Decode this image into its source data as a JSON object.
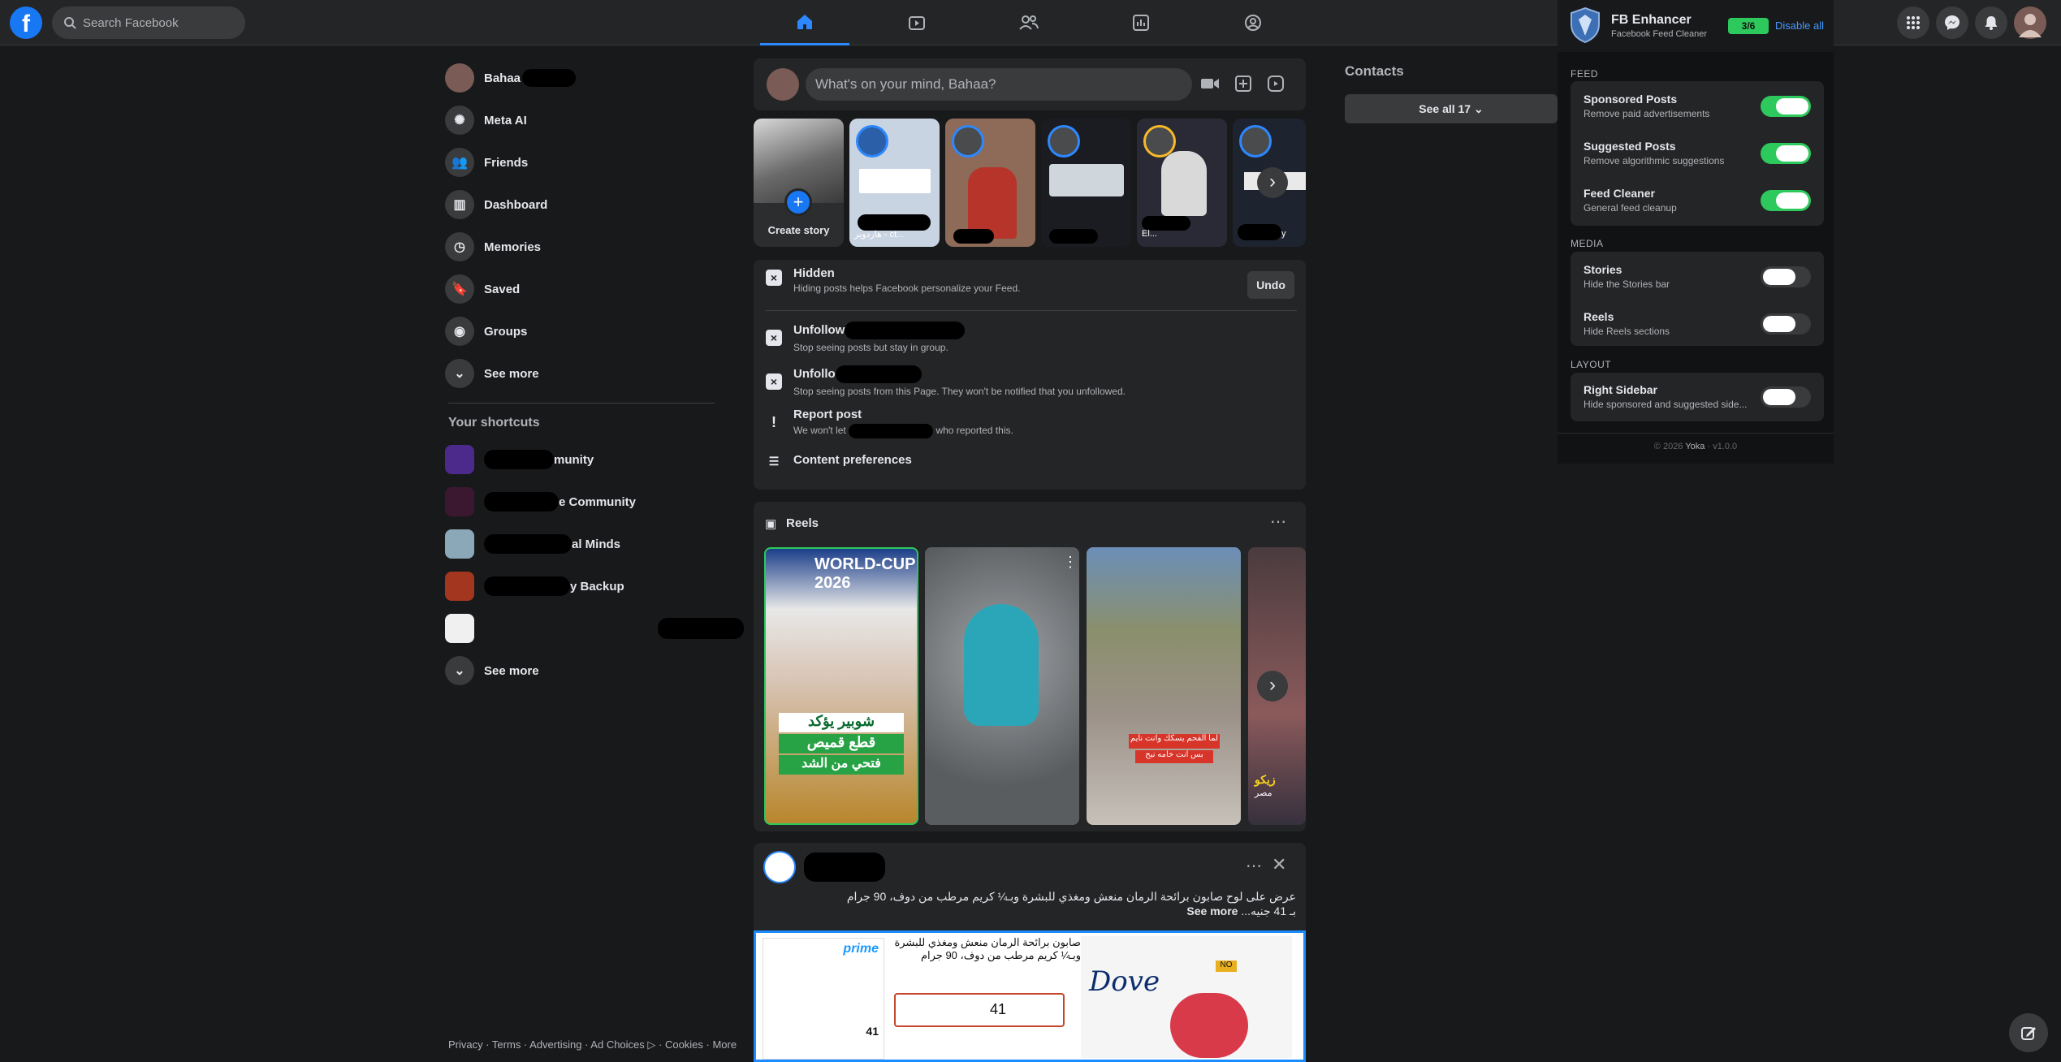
{
  "header": {
    "search_placeholder": "Search Facebook",
    "tabs": [
      "home-icon",
      "watch-icon",
      "friends-icon",
      "dashboard-icon",
      "gaming-icon"
    ],
    "accent": "#1877f2"
  },
  "left_nav": {
    "user_name": "Bahaa",
    "items": [
      {
        "label": "Meta AI",
        "icon": "meta-ai-icon"
      },
      {
        "label": "Friends",
        "icon": "friends-icon"
      },
      {
        "label": "Dashboard",
        "icon": "dashboard-icon"
      },
      {
        "label": "Memories",
        "icon": "memories-icon"
      },
      {
        "label": "Saved",
        "icon": "saved-icon"
      },
      {
        "label": "Groups",
        "icon": "groups-icon"
      },
      {
        "label": "See more",
        "icon": "chevron-down-icon"
      }
    ],
    "shortcuts_title": "Your shortcuts",
    "shortcuts": [
      {
        "label": "munity"
      },
      {
        "label": "e Community"
      },
      {
        "label": "al Minds"
      },
      {
        "label": "y Backup"
      },
      {
        "label": ""
      }
    ],
    "shortcuts_more": "See more",
    "footer": "Privacy · Terms · Advertising · Ad Choices ▷ · Cookies · More"
  },
  "composer": {
    "placeholder": "What's on your mind, Bahaa?"
  },
  "stories": {
    "create_label": "Create story",
    "items": [
      {
        "label": "هاردوير - ct..."
      },
      {
        "label": ""
      },
      {
        "label": ""
      },
      {
        "label": "El..."
      },
      {
        "label": "y"
      }
    ]
  },
  "hidden_panel": {
    "title": "Hidden",
    "subtitle": "Hiding posts helps Facebook personalize your Feed.",
    "undo": "Undo",
    "rows": [
      {
        "title": "Unfollow",
        "sub": "Stop seeing posts but stay in group."
      },
      {
        "title": "Unfollo",
        "sub": "Stop seeing posts from this Page. They won't be notified that you unfollowed."
      },
      {
        "title": "Report post",
        "sub": "We won't let",
        "sub_tail": "who reported this."
      },
      {
        "title": "Content preferences",
        "sub": ""
      }
    ]
  },
  "reels": {
    "title": "Reels",
    "items": [
      {
        "caption_1": "شوبير يؤكد",
        "caption_2": "قطع قميص",
        "caption_3": "فتحي من الشد",
        "badge": "WORLD-CUP 2026"
      },
      {
        "caption_1": ""
      },
      {
        "caption_1": "لما الفحم يسكك وانت نايم",
        "caption_2": "بس انت خامه نبح"
      },
      {
        "caption_1": "زيكو",
        "caption_2": "مصر"
      }
    ]
  },
  "post": {
    "text_line1": "عرض على لوح صابون برائحة الرمان منعش ومغذي للبشرة وبـ¼ كريم مرطب من دوف، 90 جرام",
    "text_line2": "بـ 41 جنيه...",
    "see_more": "See more",
    "product_title": "صابون برائحة الرمان منعش ومغذي للبشرة وبـ¼ كريم مرطب من دوف، 90 جرام",
    "price": "41",
    "brand": "Dove",
    "prime": "prime",
    "tag_no": "NO"
  },
  "contacts": {
    "title": "Contacts",
    "see_all": "See all 17"
  },
  "extension": {
    "title": "FB Enhancer",
    "subtitle": "Facebook Feed Cleaner",
    "count": "3/6",
    "disable_all": "Disable all",
    "sections": {
      "feed": "FEED",
      "media": "MEDIA",
      "layout": "LAYOUT"
    },
    "items": [
      {
        "name": "Sponsored Posts",
        "desc": "Remove paid advertisements",
        "on": true
      },
      {
        "name": "Suggested Posts",
        "desc": "Remove algorithmic suggestions",
        "on": true
      },
      {
        "name": "Feed Cleaner",
        "desc": "General feed cleanup",
        "on": true
      },
      {
        "name": "Stories",
        "desc": "Hide the Stories bar",
        "on": false
      },
      {
        "name": "Reels",
        "desc": "Hide Reels sections",
        "on": false
      },
      {
        "name": "Right Sidebar",
        "desc": "Hide sponsored and suggested side...",
        "on": false
      }
    ],
    "footer_prefix": "© 2026",
    "footer_brand": "Yoka",
    "footer_version": "· v1.0.0",
    "toggle_on_color": "#2ec95c"
  }
}
